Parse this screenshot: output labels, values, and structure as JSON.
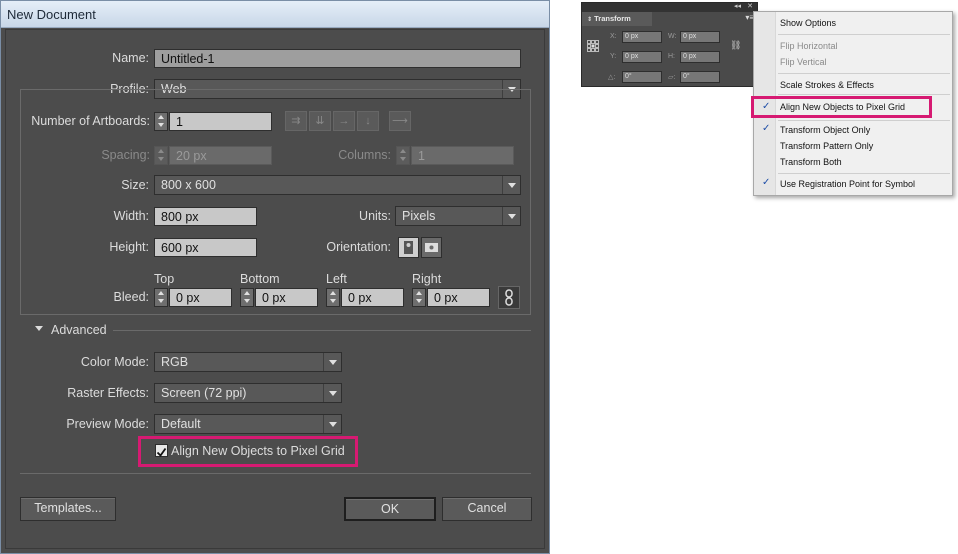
{
  "dialog": {
    "title": "New Document",
    "name": {
      "label": "Name:",
      "value": "Untitled-1"
    },
    "profile": {
      "label": "Profile:",
      "value": "Web"
    },
    "artboards": {
      "label": "Number of Artboards:",
      "value": "1"
    },
    "spacing": {
      "label": "Spacing:",
      "value": "20 px"
    },
    "columns": {
      "label": "Columns:",
      "value": "1"
    },
    "size": {
      "label": "Size:",
      "value": "800 x 600"
    },
    "width": {
      "label": "Width:",
      "value": "800 px"
    },
    "units": {
      "label": "Units:",
      "value": "Pixels"
    },
    "height": {
      "label": "Height:",
      "value": "600 px"
    },
    "orientation": {
      "label": "Orientation:"
    },
    "bleed": {
      "label": "Bleed:",
      "top": {
        "label": "Top",
        "value": "0 px"
      },
      "bottom": {
        "label": "Bottom",
        "value": "0 px"
      },
      "left": {
        "label": "Left",
        "value": "0 px"
      },
      "right": {
        "label": "Right",
        "value": "0 px"
      }
    },
    "advanced": {
      "label": "Advanced"
    },
    "color_mode": {
      "label": "Color Mode:",
      "value": "RGB"
    },
    "raster_effects": {
      "label": "Raster Effects:",
      "value": "Screen (72 ppi)"
    },
    "preview_mode": {
      "label": "Preview Mode:",
      "value": "Default"
    },
    "align_pixel_grid": {
      "label": "Align New Objects to Pixel Grid",
      "checked": true
    },
    "templates_button": "Templates...",
    "ok_button": "OK",
    "cancel_button": "Cancel"
  },
  "transform_panel": {
    "tab": "Transform",
    "x": {
      "label": "X:",
      "value": "0 px"
    },
    "y": {
      "label": "Y:",
      "value": "0 px"
    },
    "w": {
      "label": "W:",
      "value": "0 px"
    },
    "h": {
      "label": "H:",
      "value": "0 px"
    },
    "rotate": {
      "value": "0°"
    },
    "shear": {
      "value": "0°"
    }
  },
  "flyout_menu": {
    "items": [
      {
        "label": "Show Options",
        "checked": false,
        "enabled": true
      },
      {
        "label": "Flip Horizontal",
        "checked": false,
        "enabled": false
      },
      {
        "label": "Flip Vertical",
        "checked": false,
        "enabled": false
      },
      {
        "label": "Scale Strokes & Effects",
        "checked": false,
        "enabled": true
      },
      {
        "label": "Align New Objects to Pixel Grid",
        "checked": true,
        "enabled": true
      },
      {
        "label": "Transform Object Only",
        "checked": true,
        "enabled": true
      },
      {
        "label": "Transform Pattern Only",
        "checked": false,
        "enabled": true
      },
      {
        "label": "Transform Both",
        "checked": false,
        "enabled": true
      },
      {
        "label": "Use Registration Point for Symbol",
        "checked": true,
        "enabled": true
      }
    ]
  },
  "colors": {
    "highlight": "#d61a72",
    "dialog_bg": "#4c4c4c",
    "check_color": "#1f4fa8"
  }
}
